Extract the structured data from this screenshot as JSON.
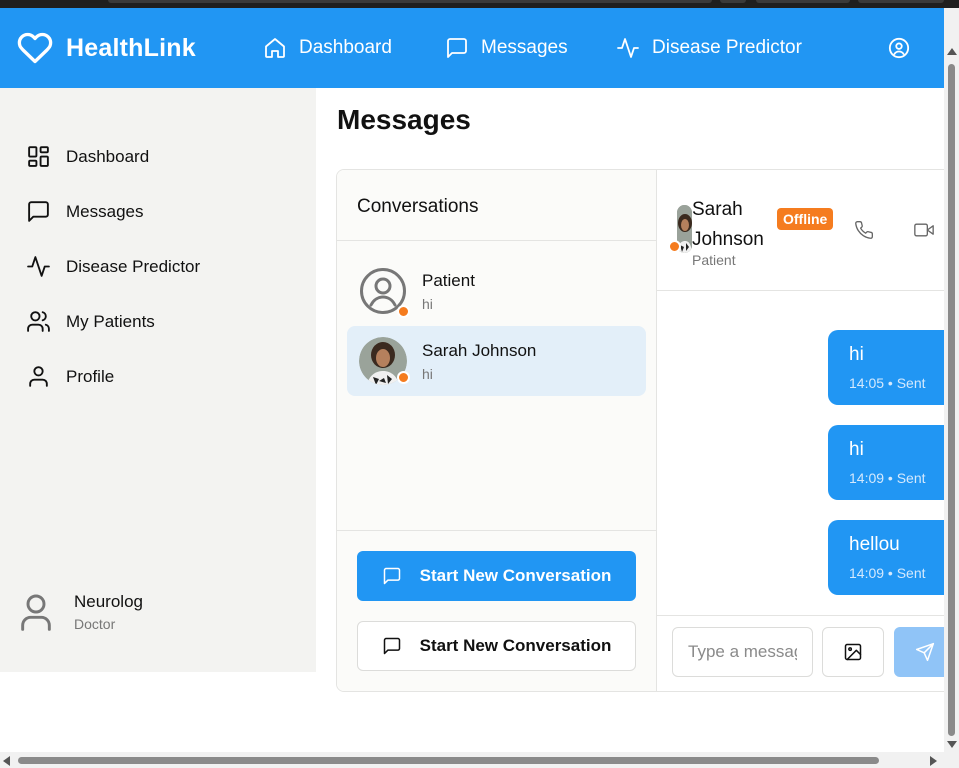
{
  "app": {
    "brand": "HealthLink",
    "accent": "#2196f3",
    "status_color": "#f57c1f"
  },
  "topnav": [
    {
      "label": "Dashboard",
      "icon": "home-icon"
    },
    {
      "label": "Messages",
      "icon": "message-square-icon"
    },
    {
      "label": "Disease Predictor",
      "icon": "activity-icon"
    }
  ],
  "sidebar": {
    "items": [
      {
        "label": "Dashboard",
        "icon": "layout-grid-icon"
      },
      {
        "label": "Messages",
        "icon": "message-square-icon"
      },
      {
        "label": "Disease Predictor",
        "icon": "activity-icon"
      },
      {
        "label": "My Patients",
        "icon": "users-icon"
      },
      {
        "label": "Profile",
        "icon": "user-icon"
      }
    ],
    "user": {
      "name": "Neurolog",
      "role": "Doctor"
    }
  },
  "page": {
    "title": "Messages"
  },
  "conversations": {
    "header": "Conversations",
    "items": [
      {
        "name": "Patient",
        "last_message": "hi",
        "status": "offline"
      },
      {
        "name": "Sarah Johnson",
        "last_message": "hi",
        "status": "offline"
      }
    ],
    "new_button_label": "Start New Conversation",
    "new_button_label_secondary": "Start New Conversation"
  },
  "chat": {
    "contact_name": "Sarah Johnson",
    "contact_role": "Patient",
    "status_badge": "Offline",
    "messages": [
      {
        "text": "hi",
        "meta": "14:05 • Sent"
      },
      {
        "text": "hi",
        "meta": "14:09 • Sent"
      },
      {
        "text": "hellou",
        "meta": "14:09 • Sent"
      }
    ],
    "input_placeholder": "Type a message..."
  }
}
